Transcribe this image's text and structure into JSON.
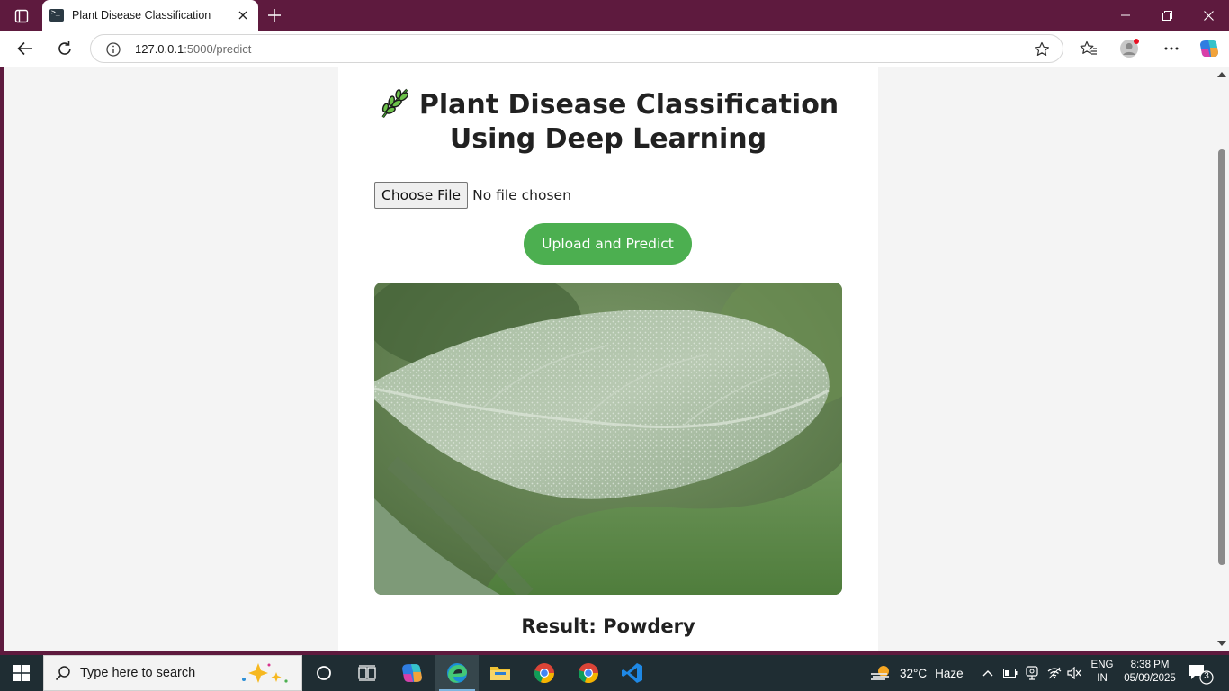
{
  "browser": {
    "tab_title": "Plant Disease Classification",
    "url_host": "127.0.0.1",
    "url_path": ":5000/predict"
  },
  "page": {
    "heading_line1": "Plant Disease Classification",
    "heading_line2": "Using Deep Learning",
    "choose_file_label": "Choose File",
    "file_status": "No file chosen",
    "upload_button": "Upload and Predict",
    "result_text": "Result: Powdery"
  },
  "taskbar": {
    "search_placeholder": "Type here to search",
    "weather_temp": "32°C",
    "weather_condition": "Haze",
    "lang_line1": "ENG",
    "lang_line2": "IN",
    "time": "8:38 PM",
    "date": "05/09/2025",
    "notification_count": "3"
  },
  "colors": {
    "titlebar": "#5e1a3e",
    "accent_button": "#4caf50",
    "page_bg": "#f4f4f4",
    "taskbar": "#1f2d33"
  }
}
